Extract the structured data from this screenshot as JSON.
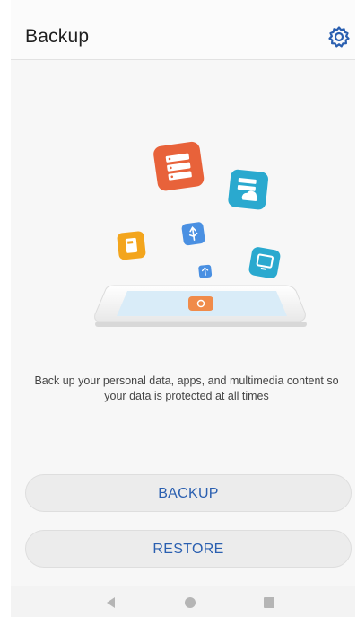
{
  "appbar": {
    "title": "Backup",
    "settings_icon": "gear-icon"
  },
  "main": {
    "description": "Back up your personal data, apps, and multimedia content so your data is protected at all times"
  },
  "actions": {
    "backup_label": "BACKUP",
    "restore_label": "RESTORE"
  },
  "navigation": {
    "back_icon": "back-triangle-icon",
    "home_icon": "home-circle-icon",
    "recent_icon": "recent-square-icon"
  },
  "colors": {
    "accent": "#2a5fb0",
    "orange": "#e8623a",
    "teal": "#2aa9cf",
    "yellow": "#f3a51d",
    "blue": "#4a90e2"
  }
}
